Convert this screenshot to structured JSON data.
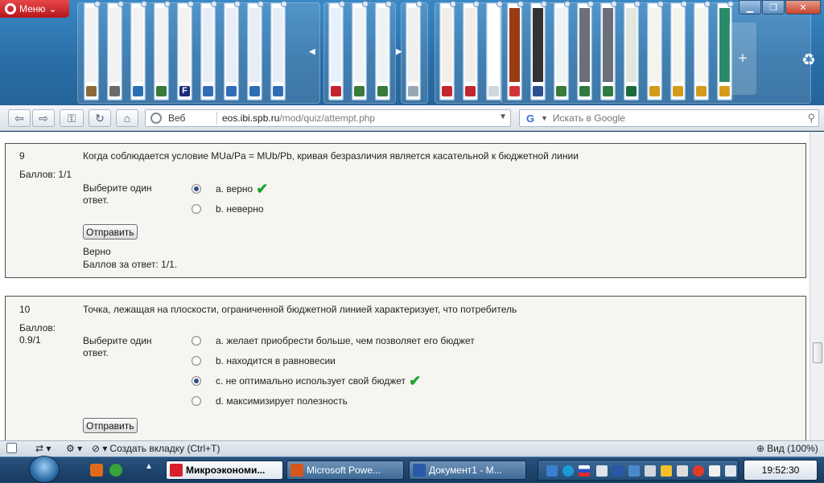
{
  "browser": {
    "menu_label": "Меню",
    "web_label": "Веб",
    "url_host": "eos.ibi.spb.ru",
    "url_path": "/mod/quiz/attempt.php",
    "search_placeholder": "Искать в Google"
  },
  "tabs": [
    {
      "fav": "#8a6a3a",
      "pic": "#f2f2f2"
    },
    {
      "fav": "#6b6b6b",
      "pic": "#f2f2f2"
    },
    {
      "fav": "#2b6fb3",
      "pic": "#f2f2f2"
    },
    {
      "fav": "#3a7a3a",
      "pic": "#f2f2f2"
    },
    {
      "fav": "#1a2a7a",
      "pic": "#f2f2f2",
      "glyph": "F"
    },
    {
      "fav": "#2f6db5",
      "pic": "#e8eef6"
    },
    {
      "fav": "#2f6db5",
      "pic": "#e8eef6"
    },
    {
      "fav": "#2f6db5",
      "pic": "#e8eef6"
    },
    {
      "fav": "#2f6db5",
      "pic": "#e8eef6"
    },
    {
      "fav": "#c2262e",
      "pic": "#e7f0fb"
    },
    {
      "fav": "#3a7a3a",
      "pic": "#eef3f6"
    },
    {
      "fav": "#3a7a3a",
      "pic": "#eef3f6"
    },
    {
      "fav": "#9aa7b4",
      "pic": "#f0f0f0"
    },
    {
      "fav": "#c2262e",
      "pic": "#f3efe8"
    },
    {
      "fav": "#c2262e",
      "pic": "#f3efe8"
    },
    {
      "fav": "#cfd6de",
      "pic": "#ffffff"
    },
    {
      "fav": "#d4333a",
      "pic": "#9a3c12"
    },
    {
      "fav": "#2b4f8f",
      "pic": "#333333"
    },
    {
      "fav": "#3a7a3a",
      "pic": "#eef3f6"
    },
    {
      "fav": "#2f7a3f",
      "pic": "#6a6f7a"
    },
    {
      "fav": "#2f7a3f",
      "pic": "#6a6f7a"
    },
    {
      "fav": "#1a6b3a",
      "pic": "#dfe7df"
    },
    {
      "fav": "#d49a1a",
      "pic": "#f4f4ee"
    },
    {
      "fav": "#d49a1a",
      "pic": "#f4f4ee"
    },
    {
      "fav": "#d49a1a",
      "pic": "#f4f4ee"
    },
    {
      "fav": "#d49a1a",
      "pic": "#2a8a6a"
    }
  ],
  "questions": [
    {
      "number": "9",
      "grade": "Баллов: 1/1",
      "text": "Когда соблюдается условие MUa/Pa = MUb/Pb, кривая безразличия является касательной к бюджетной линии",
      "prompt": "Выберите один ответ.",
      "answers": [
        {
          "label": "a. верно",
          "selected": true,
          "correct": true
        },
        {
          "label": "b. неверно",
          "selected": false,
          "correct": false
        }
      ],
      "submit": "Отправить",
      "feedback": "Верно",
      "mark": "Баллов за ответ: 1/1."
    },
    {
      "number": "10",
      "grade": "Баллов: 0.9/1",
      "text": "Точка, лежащая на плоскости, ограниченной бюджетной линией характеризует, что потребитель",
      "prompt": "Выберите один ответ.",
      "answers": [
        {
          "label": "a. желает приобрести больше, чем позволяет его бюджет",
          "selected": false,
          "correct": false
        },
        {
          "label": "b. находится в равновесии",
          "selected": false,
          "correct": false
        },
        {
          "label": "c. не оптимально использует свой бюджет",
          "selected": true,
          "correct": true
        },
        {
          "label": "d. максимизирует полезность",
          "selected": false,
          "correct": false
        }
      ],
      "submit": "Отправить"
    }
  ],
  "statusbar": {
    "new_tab": "Создать вкладку (Ctrl+T)",
    "zoom": "Вид (100%)"
  },
  "taskbar": {
    "buttons": [
      {
        "label": "Микроэкономи...",
        "active": true,
        "color": "#d8202a"
      },
      {
        "label": "Microsoft Powe...",
        "active": false,
        "color": "#d6561c"
      },
      {
        "label": "Документ1 - М...",
        "active": false,
        "color": "#2b5aa8"
      }
    ],
    "clock": "19:52:30"
  }
}
